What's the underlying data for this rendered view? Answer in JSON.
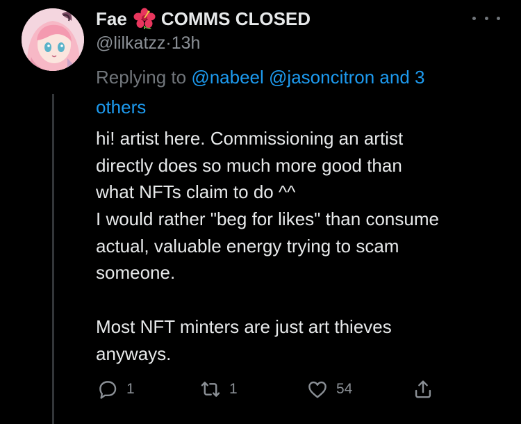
{
  "tweet": {
    "display_name": "Fae",
    "name_emoji": "hibiscus-icon",
    "name_suffix": "COMMS CLOSED",
    "handle": "@lilkatzz",
    "separator": "·",
    "time": "13h",
    "replying_prefix": "Replying to",
    "replying_mentions": [
      "@nabeel",
      "@jasoncitron"
    ],
    "replying_and": "and",
    "replying_others": "3",
    "replying_others_word": "others",
    "body_lines": [
      "hi! artist here. Commissioning an artist",
      "directly does so much more good than",
      "what NFTs claim to do ^^",
      "I would rather \"beg for likes\" than consume",
      "actual, valuable energy trying to scam",
      "someone.",
      "",
      "Most NFT minters are just art thieves",
      "anyways."
    ],
    "counts": {
      "replies": "1",
      "retweets": "1",
      "likes": "54"
    }
  },
  "colors": {
    "background": "#000000",
    "text": "#e7e9ea",
    "muted": "#71767b",
    "link": "#1d9bf0",
    "flower": "#e8365d",
    "thread_line": "#333639"
  }
}
